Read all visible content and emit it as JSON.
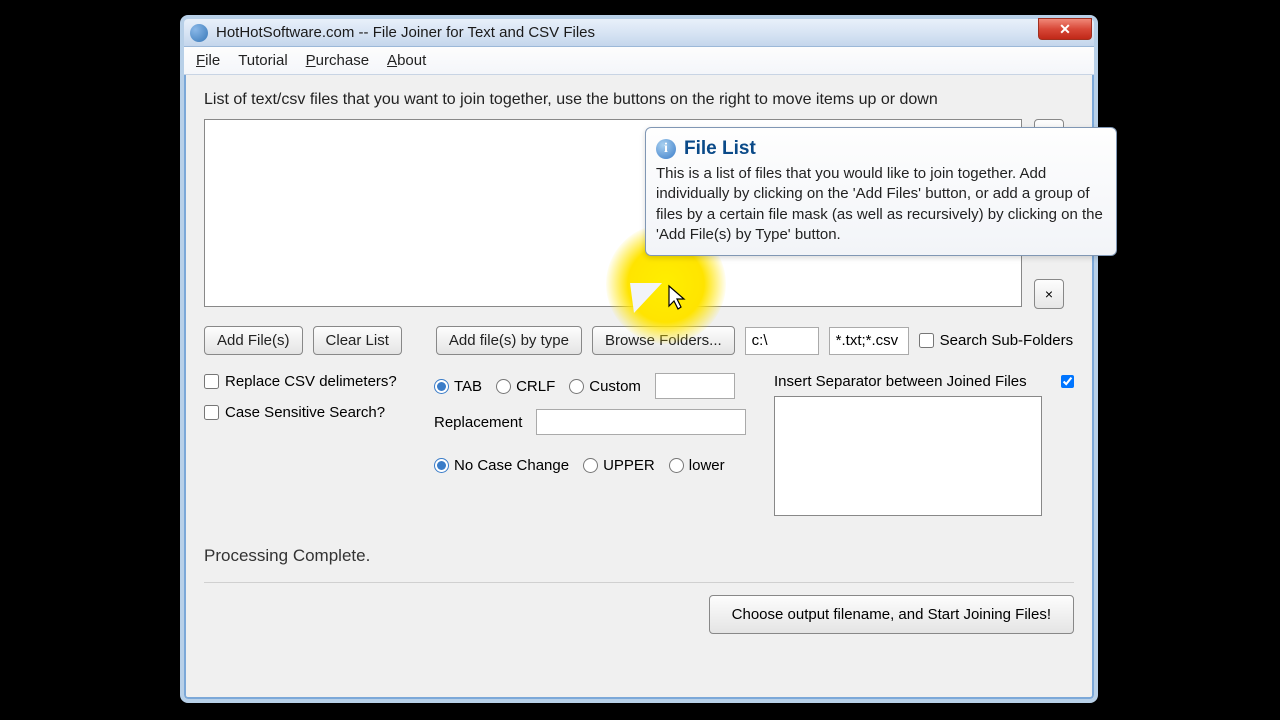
{
  "window": {
    "title": "HotHotSoftware.com -- File Joiner for Text and CSV Files"
  },
  "menu": {
    "file": "File",
    "tutorial": "Tutorial",
    "purchase": "Purchase",
    "about": "About"
  },
  "instruction": "List of text/csv files that you want to join together, use the buttons on the right to move items up or down",
  "tooltip": {
    "title": "File List",
    "body": "This is a list of files that you would like to join together. Add individually by clicking on the 'Add Files' button, or add a group of files by a certain file mask (as well as recursively) by clicking on the 'Add File(s) by Type' button."
  },
  "buttons": {
    "add_files": "Add File(s)",
    "clear_list": "Clear List",
    "add_by_type": "Add file(s) by type",
    "browse_folders": "Browse Folders...",
    "close_x": "×",
    "start": "Choose output filename, and Start Joining Files!"
  },
  "inputs": {
    "path": "c:\\",
    "mask": "*.txt;*.csv"
  },
  "checkboxes": {
    "search_sub": "Search Sub-Folders",
    "replace_delim": "Replace CSV delimeters?",
    "case_sensitive": "Case Sensitive Search?",
    "insert_sep": "Insert Separator between Joined Files"
  },
  "radios": {
    "tab": "TAB",
    "crlf": "CRLF",
    "custom": "Custom",
    "no_case": "No Case Change",
    "upper": "UPPER",
    "lower": "lower"
  },
  "labels": {
    "replacement": "Replacement"
  },
  "status": "Processing Complete."
}
